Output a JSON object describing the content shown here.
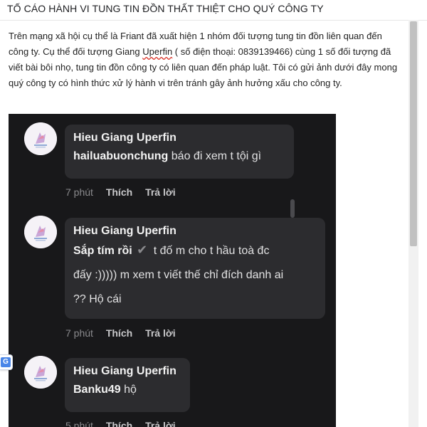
{
  "subject": "TỐ CÁO HÀNH VI TUNG TIN ĐỒN THẤT THIỆT CHO QUÝ CÔNG TY",
  "body": {
    "line1": "Trên mạng xã hội cụ thể là Friant đã xuất hiện 1 nhóm đối tượng tung tin đồn liên quan đến",
    "line2_before": "công ty. Cụ thể đối tượng Giang ",
    "line2_flagged": "Uperfin",
    "line2_after": "  ( số điện thoại: 0839139466) cùng 1 số đối tượng đã",
    "line3": "viết bài bôi nhọ, tung tin đồn công ty có liên quan đến pháp luật. Tôi có gửi ảnh dưới đây mong",
    "line4": "quý công ty có hình thức xử lý hành vi trên tránh gây ảnh hưởng xấu cho công ty."
  },
  "comments": [
    {
      "author": "Hieu Giang Uperfin",
      "mention": "hailuabuonchung",
      "text": " báo đi xem t tội gì",
      "time": "7 phút",
      "like": "Thích",
      "reply": "Trả lời"
    },
    {
      "author": "Hieu Giang Uperfin",
      "mention": "Sắp tím rồi",
      "line1_rest": "t đố m cho t hầu toà đc",
      "line2": "đấy :))))) m xem t viết thế chỉ đích danh ai",
      "line3": "?? Hộ cái",
      "time": "7 phút",
      "like": "Thích",
      "reply": "Trả lời"
    },
    {
      "author": "Hieu Giang Uperfin",
      "mention": "Banku49",
      "text": " hộ",
      "time": "5 phút",
      "like": "Thích",
      "reply": "Trả lời"
    }
  ],
  "icons": {
    "avatar": "avatar-illustration-icon",
    "check": "check-mark-icon",
    "extension": "translate-extension-icon"
  },
  "colors": {
    "screenshot_bg": "#18181a",
    "bubble_bg": "#2c2c2f",
    "meta_text": "#8a8a8d",
    "spellcheck": "#d93025"
  }
}
